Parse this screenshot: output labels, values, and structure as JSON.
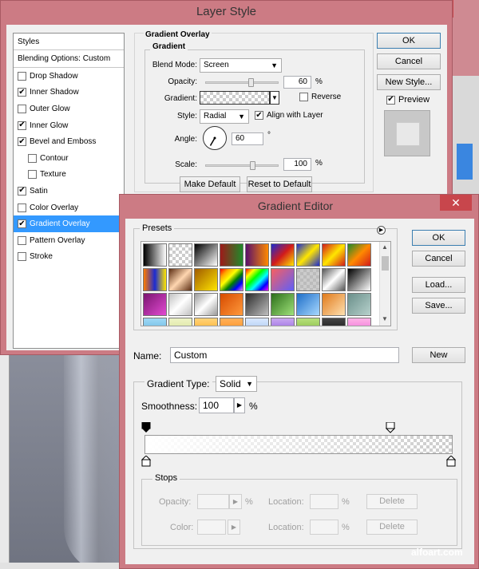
{
  "layer_style": {
    "title": "Layer Style",
    "styles_header": "Styles",
    "blending_options": "Blending Options: Custom",
    "items": [
      {
        "label": "Drop Shadow",
        "checked": false,
        "sub": false
      },
      {
        "label": "Inner Shadow",
        "checked": true,
        "sub": false
      },
      {
        "label": "Outer Glow",
        "checked": false,
        "sub": false
      },
      {
        "label": "Inner Glow",
        "checked": true,
        "sub": false
      },
      {
        "label": "Bevel and Emboss",
        "checked": true,
        "sub": false
      },
      {
        "label": "Contour",
        "checked": false,
        "sub": true
      },
      {
        "label": "Texture",
        "checked": false,
        "sub": true
      },
      {
        "label": "Satin",
        "checked": true,
        "sub": false
      },
      {
        "label": "Color Overlay",
        "checked": false,
        "sub": false
      },
      {
        "label": "Gradient Overlay",
        "checked": true,
        "sub": false,
        "selected": true
      },
      {
        "label": "Pattern Overlay",
        "checked": false,
        "sub": false
      },
      {
        "label": "Stroke",
        "checked": false,
        "sub": false
      }
    ],
    "group_title": "Gradient Overlay",
    "inner_title": "Gradient",
    "blend_mode_label": "Blend Mode:",
    "blend_mode_value": "Screen",
    "opacity_label": "Opacity:",
    "opacity_value": "60",
    "opacity_fraction": 0.6,
    "percent": "%",
    "gradient_label": "Gradient:",
    "reverse_label": "Reverse",
    "reverse_checked": false,
    "style_label": "Style:",
    "style_value": "Radial",
    "align_label": "Align with Layer",
    "align_checked": true,
    "angle_label": "Angle:",
    "angle_value": "60",
    "degree": "°",
    "scale_label": "Scale:",
    "scale_value": "100",
    "make_default": "Make Default",
    "reset_default": "Reset to Default",
    "ok": "OK",
    "cancel": "Cancel",
    "new_style": "New Style...",
    "preview_label": "Preview",
    "preview_checked": true
  },
  "gradient_editor": {
    "title": "Gradient Editor",
    "close_glyph": "✕",
    "presets_label": "Presets",
    "ok": "OK",
    "cancel": "Cancel",
    "load": "Load...",
    "save": "Save...",
    "name_label": "Name:",
    "name_value": "Custom",
    "new": "New",
    "gradient_type_label": "Gradient Type:",
    "gradient_type_value": "Solid",
    "smoothness_label": "Smoothness:",
    "smoothness_value": "100",
    "percent": "%",
    "stops_label": "Stops",
    "opacity_label": "Opacity:",
    "color_label": "Color:",
    "location_label": "Location:",
    "delete": "Delete",
    "swatches": [
      "linear-gradient(90deg,#000,#fff)",
      "checker-white",
      "linear-gradient(135deg,#000,#fff)",
      "linear-gradient(90deg,#9e1a1a,#1f8a2a)",
      "linear-gradient(90deg,#5a0f6b,#ff8a00)",
      "linear-gradient(135deg,#1b2bd1,#d11b1b,#ffe600)",
      "linear-gradient(135deg,#1b2bd1,#ffe600,#1b2bd1)",
      "linear-gradient(135deg,#d11b1b,#ffe600,#d11b1b)",
      "linear-gradient(135deg,#1f8a2a,#ff8a00,#d11b1b)",
      "linear-gradient(90deg,#ff7a00,#1b2bd1,#ffe600)",
      "linear-gradient(135deg,#5b2d12,#ffd6b0,#5b2d12)",
      "linear-gradient(135deg,#a05a00,#ffe600)",
      "linear-gradient(135deg,red,orange,yellow,green,blue,violet)",
      "linear-gradient(135deg,red,yellow,lime,cyan,blue,magenta)",
      "checker-color",
      "checker-grey",
      "linear-gradient(135deg,#555,#fff,#555)",
      "linear-gradient(135deg,#000,#fff)",
      "linear-gradient(135deg,#7a1570,#e24ad2)",
      "linear-gradient(135deg,#c0c0c0,#fff,#c0c0c0)",
      "linear-gradient(135deg,#999,#fff,#999)",
      "linear-gradient(135deg,#d64a00,#ff9a3c)",
      "linear-gradient(135deg,#2a2a2a,#bfbfbf)",
      "linear-gradient(135deg,#2c6e1a,#9fe27a)",
      "linear-gradient(135deg,#1e6ec8,#a7d8ff)",
      "linear-gradient(135deg,#e07a1a,#ffe0b0)",
      "linear-gradient(135deg,#6a8f8a,#b7d1cc)",
      "linear-gradient(180deg,#9fd8f5,#4aa6d6)",
      "linear-gradient(180deg,#eef3c5,#cfdc85)",
      "linear-gradient(180deg,#ffd47a,#ff9a00)",
      "linear-gradient(180deg,#ffb15a,#ff7a00)",
      "linear-gradient(180deg,#d9e8ff,#8fb5e8)",
      "linear-gradient(180deg,#c8a7f0,#7a3fd6)",
      "linear-gradient(180deg,#b7e07a,#6aa82a)",
      "linear-gradient(180deg,#444,#000)",
      "linear-gradient(180deg,#ffb3e6,#e24ad2)"
    ]
  },
  "watermark": "alfoart.com",
  "colors": {
    "title_bar": "#cc7b84",
    "dialog_bg": "#f0f0f0",
    "selected": "#3399ff",
    "close": "#c8464c"
  },
  "bg_close_glyph": "✕"
}
